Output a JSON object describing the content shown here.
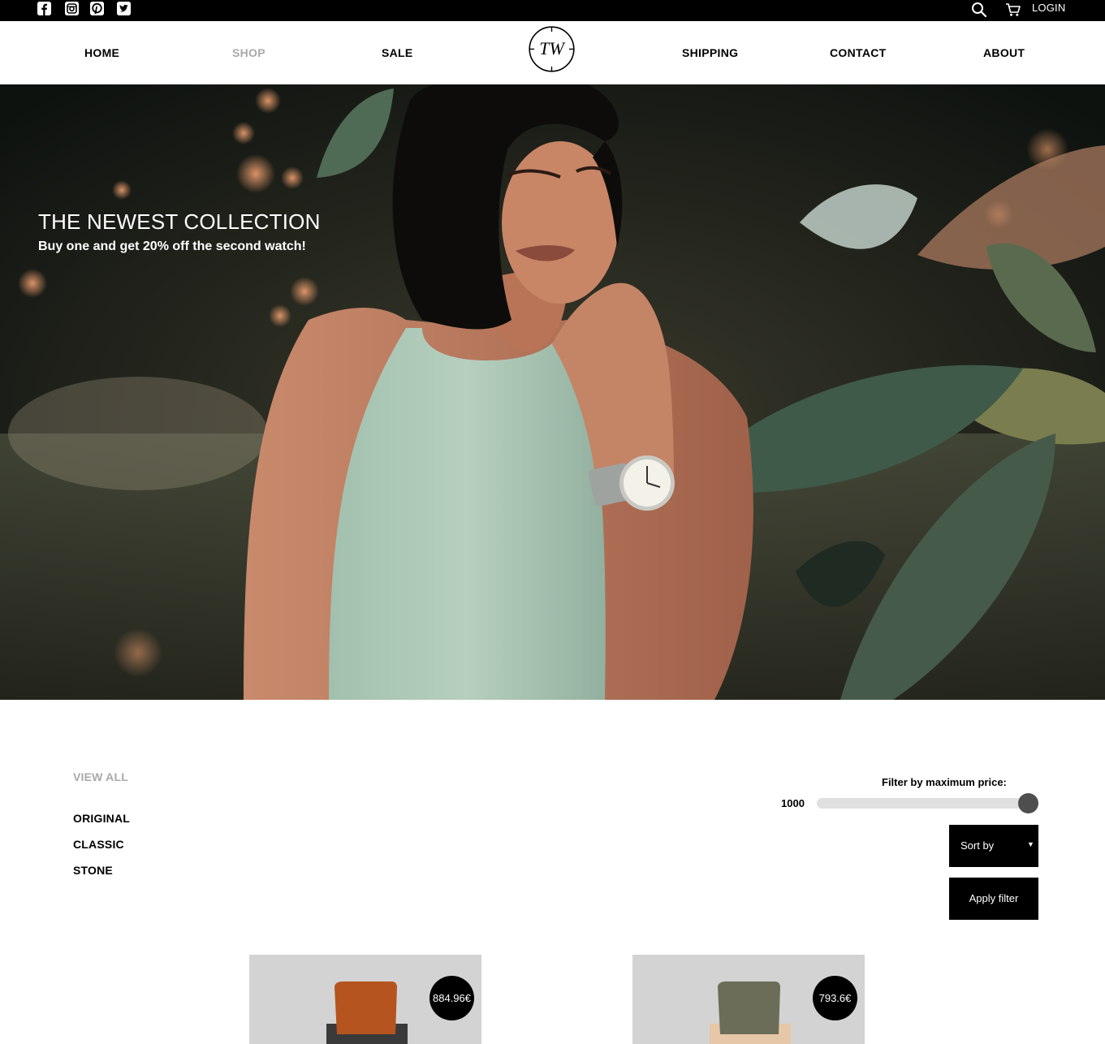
{
  "topbar": {
    "social": [
      {
        "name": "facebook",
        "glyph": "f"
      },
      {
        "name": "instagram",
        "glyph": ""
      },
      {
        "name": "pinterest",
        "glyph": ""
      },
      {
        "name": "twitter",
        "glyph": ""
      }
    ],
    "login_label": "LOGIN"
  },
  "nav": {
    "items": [
      "HOME",
      "SHOP",
      "SALE",
      "SHIPPING",
      "CONTACT",
      "ABOUT"
    ],
    "active": "SHOP",
    "logo_text": "TW"
  },
  "hero": {
    "title": "THE NEWEST COLLECTION",
    "subtitle": "Buy one and get 20% off the second watch!"
  },
  "filters": {
    "view_all": "VIEW ALL",
    "categories": [
      "ORIGINAL",
      "CLASSIC",
      "STONE"
    ],
    "price_label": "Filter by maximum price:",
    "price_value": "1000",
    "slider_fraction": 1.0,
    "sort_label": "Sort by",
    "sort_caret": "▼",
    "apply_label": "Apply filter"
  },
  "products": [
    {
      "price": "884.96€",
      "strap_color": "#b5541f"
    },
    {
      "price": "793.6€",
      "strap_color": "#6b6d58"
    }
  ]
}
